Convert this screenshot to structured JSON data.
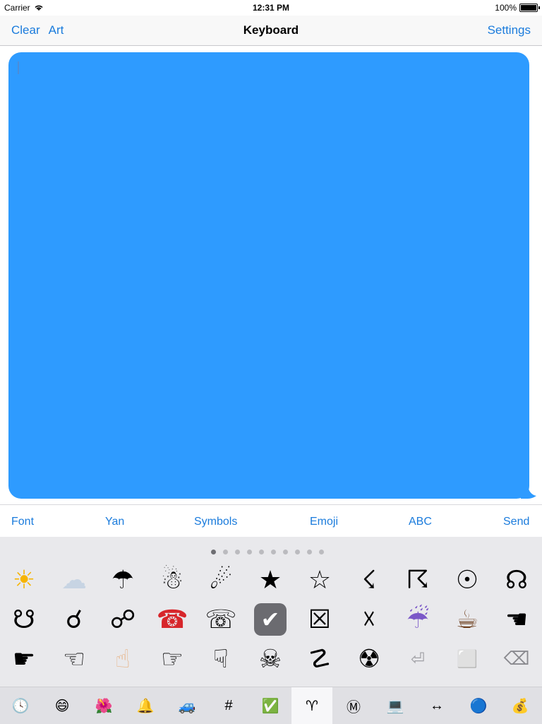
{
  "status": {
    "carrier": "Carrier",
    "time": "12:31 PM",
    "battery": "100%"
  },
  "nav": {
    "clear": "Clear",
    "art": "Art",
    "title": "Keyboard",
    "settings": "Settings"
  },
  "tabs": {
    "font": "Font",
    "yan": "Yan",
    "symbols": "Symbols",
    "emoji": "Emoji",
    "abc": "ABC",
    "send": "Send"
  },
  "keys": {
    "row1": [
      "☀",
      "☁",
      "☂",
      "☃",
      "☄",
      "★",
      "☆",
      "☇",
      "☈",
      "☉",
      "☊"
    ],
    "row2": [
      "☋",
      "☌",
      "☍",
      "☎",
      "☏",
      "✔",
      "☒",
      "☓",
      "☔",
      "☕",
      "☚"
    ],
    "row3": [
      "☛",
      "☜",
      "☝",
      "☞",
      "☟",
      "☠",
      "☡",
      "☢",
      "⏎",
      "⬜",
      "⌫"
    ]
  },
  "categories": [
    "🕓",
    "😄",
    "🌺",
    "🔔",
    "🚙",
    "#",
    "✅",
    "♈",
    "Ⓜ",
    "💻",
    "↔",
    "🔵",
    "💰"
  ],
  "page_dots": {
    "count": 10,
    "active": 0
  },
  "colors": {
    "accent": "#1a7bdc",
    "bubble": "#2e9bff"
  }
}
